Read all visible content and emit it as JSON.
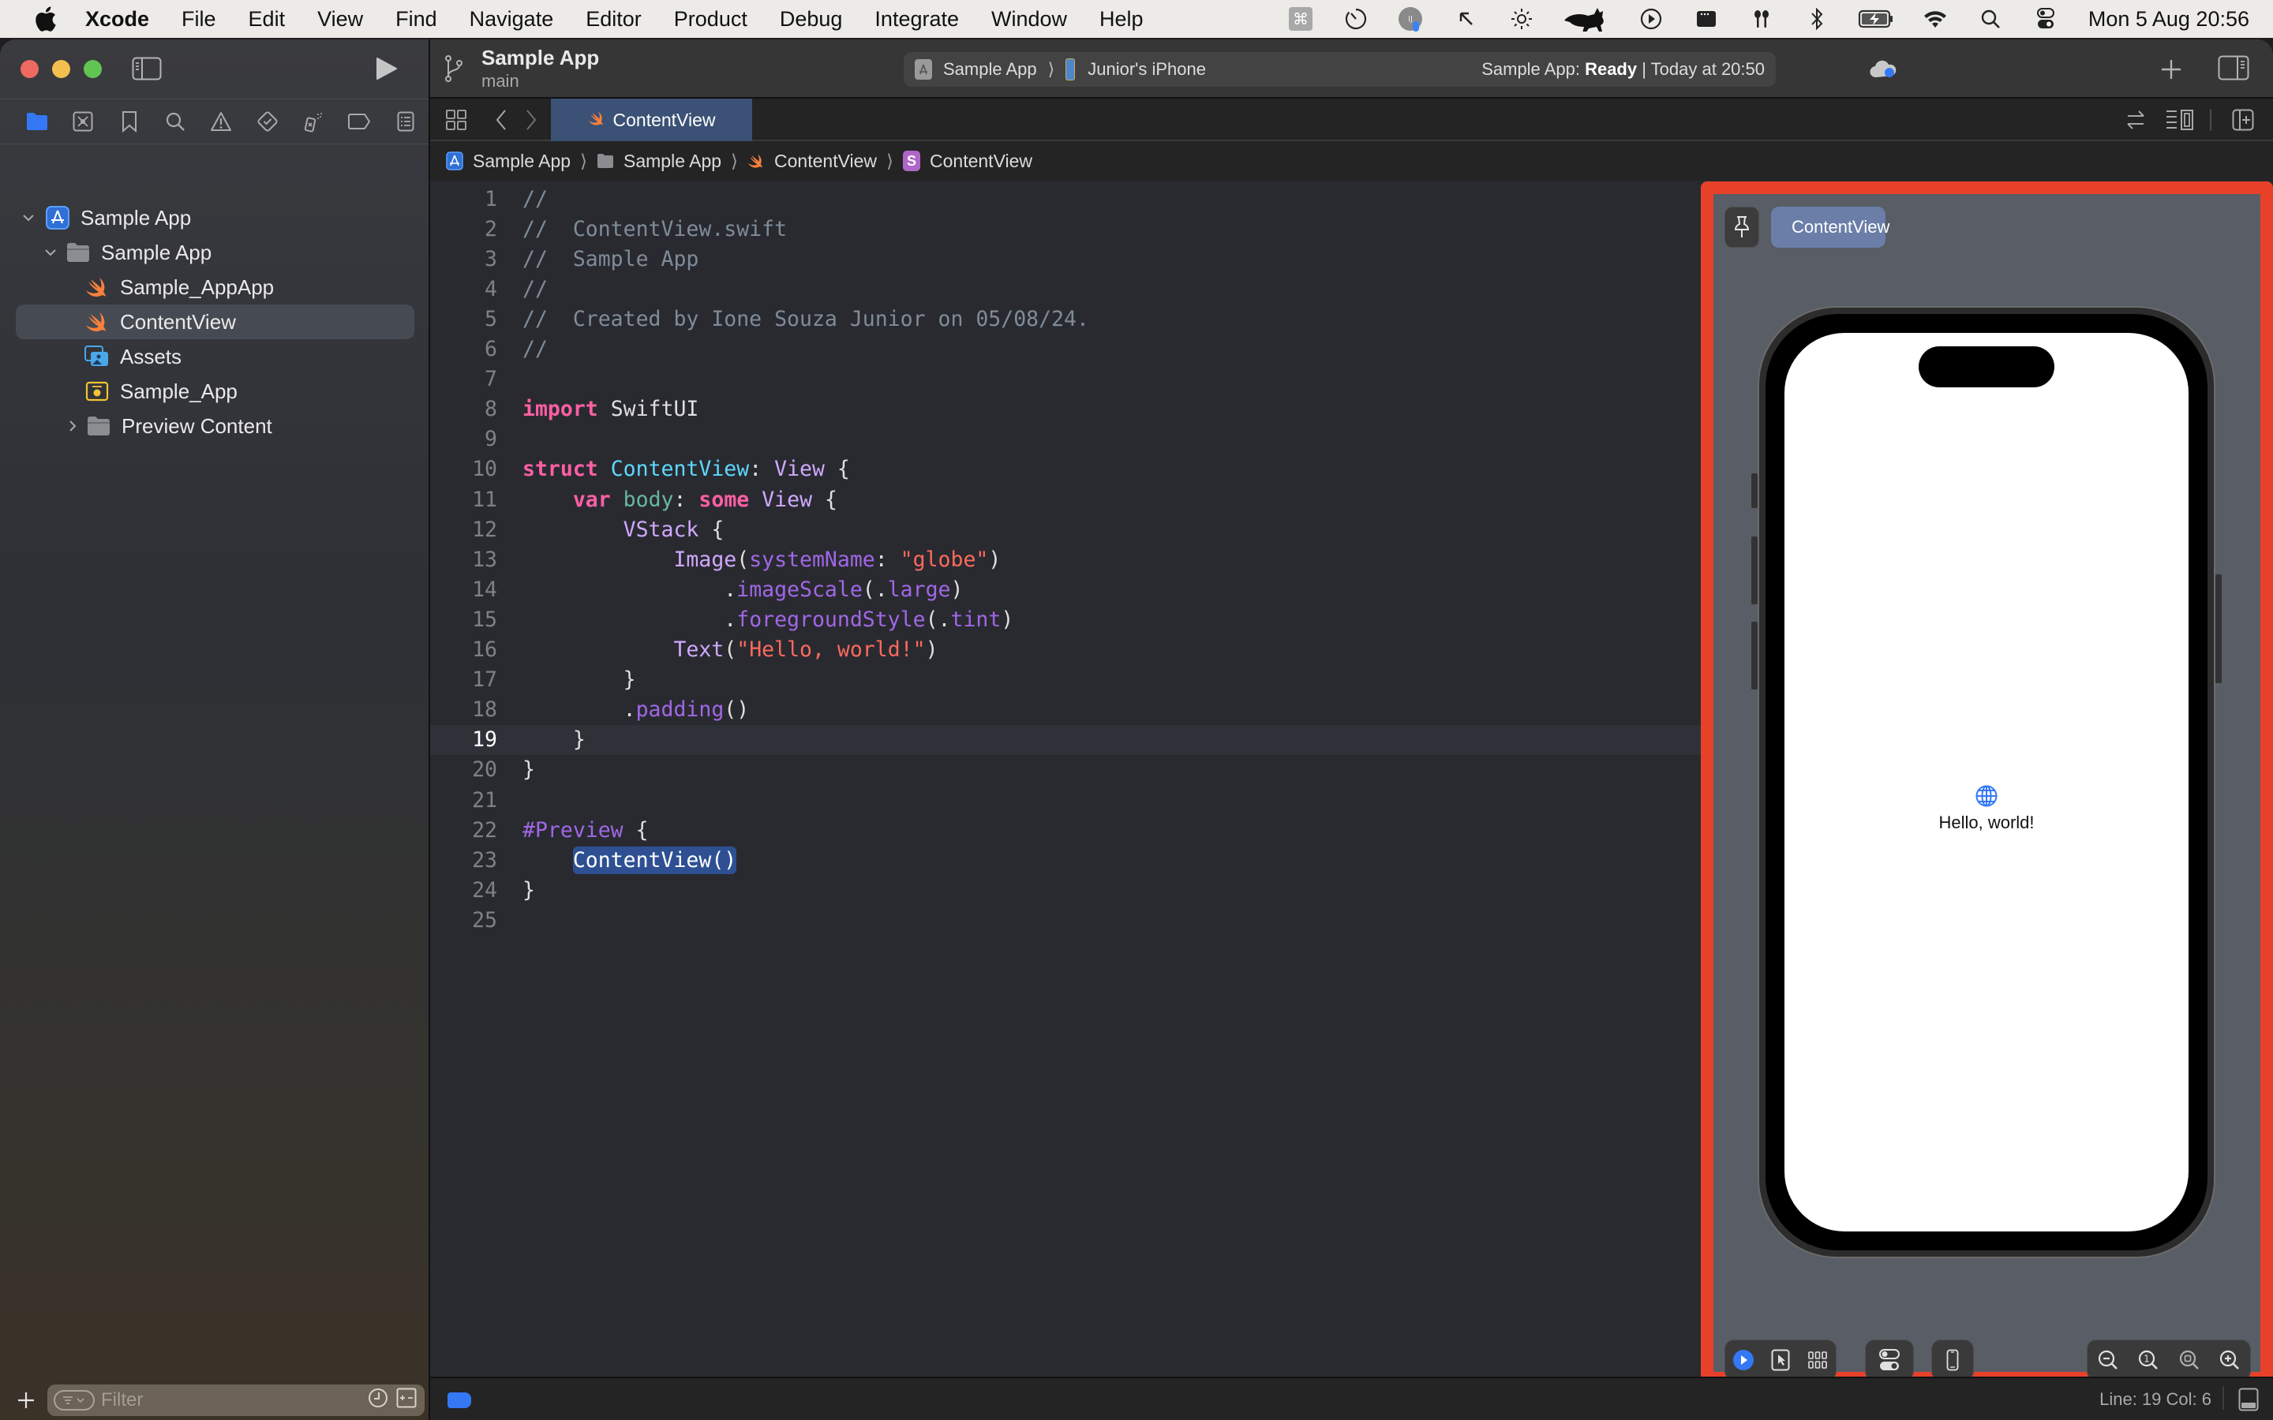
{
  "menubar": {
    "app_name": "Xcode",
    "items": [
      "File",
      "Edit",
      "View",
      "Find",
      "Navigate",
      "Editor",
      "Product",
      "Debug",
      "Integrate",
      "Window",
      "Help"
    ],
    "status_icons": [
      "command-key-icon",
      "timer-icon",
      "user-avatar-icon",
      "cursor-arrow-icon",
      "brightness-icon",
      "cat-icon",
      "play-circle-icon",
      "dock-icon",
      "airpods-icon",
      "bluetooth-icon",
      "battery-charging-icon",
      "wifi-icon",
      "spotlight-search-icon",
      "control-center-icon"
    ],
    "clock": "Mon 5 Aug  20:56",
    "avatar_initials": "IJ"
  },
  "toolbar": {
    "project_name": "Sample App",
    "branch": "main",
    "scheme": "Sample App",
    "device": "Junior's iPhone",
    "status_prefix": "Sample App: ",
    "status_state": "Ready",
    "status_suffix": " | Today at 20:50"
  },
  "navigator": {
    "tabs": [
      "project-navigator",
      "source-control-navigator",
      "bookmark-navigator",
      "find-navigator",
      "issue-navigator",
      "test-navigator",
      "debug-navigator",
      "breakpoint-navigator",
      "report-navigator"
    ],
    "active_tab": "project-navigator",
    "tree": [
      {
        "label": "Sample App",
        "type": "project",
        "level": 0,
        "expanded": true
      },
      {
        "label": "Sample App",
        "type": "folder",
        "level": 1,
        "expanded": true
      },
      {
        "label": "Sample_AppApp",
        "type": "swift",
        "level": 2
      },
      {
        "label": "ContentView",
        "type": "swift",
        "level": 2,
        "selected": true
      },
      {
        "label": "Assets",
        "type": "assets",
        "level": 2
      },
      {
        "label": "Sample_App",
        "type": "entitlements",
        "level": 2
      },
      {
        "label": "Preview Content",
        "type": "folder",
        "level": 2,
        "expanded": false
      }
    ],
    "filter_placeholder": "Filter"
  },
  "tabs": [
    {
      "label": "ContentView",
      "active": true
    }
  ],
  "breadcrumb": [
    {
      "label": "Sample App",
      "icon": "project-icon"
    },
    {
      "label": "Sample App",
      "icon": "folder-icon"
    },
    {
      "label": "ContentView",
      "icon": "swift-file-icon"
    },
    {
      "label": "ContentView",
      "icon": "struct-icon",
      "badge": "S"
    }
  ],
  "editor": {
    "current_line": 19,
    "lines": [
      [
        {
          "t": "//",
          "c": "comment"
        }
      ],
      [
        {
          "t": "//  ContentView.swift",
          "c": "comment"
        }
      ],
      [
        {
          "t": "//  Sample App",
          "c": "comment"
        }
      ],
      [
        {
          "t": "//",
          "c": "comment"
        }
      ],
      [
        {
          "t": "//  Created by Ione Souza Junior on 05/08/24.",
          "c": "comment"
        }
      ],
      [
        {
          "t": "//",
          "c": "comment"
        }
      ],
      [],
      [
        {
          "t": "import",
          "c": "keyword"
        },
        {
          "t": " SwiftUI",
          "c": "plain"
        }
      ],
      [],
      [
        {
          "t": "struct",
          "c": "keyword"
        },
        {
          "t": " ",
          "c": "plain"
        },
        {
          "t": "ContentView",
          "c": "type"
        },
        {
          "t": ": ",
          "c": "plain"
        },
        {
          "t": "View",
          "c": "sys"
        },
        {
          "t": " {",
          "c": "plain"
        }
      ],
      [
        {
          "t": "    ",
          "c": "plain"
        },
        {
          "t": "var",
          "c": "keyword"
        },
        {
          "t": " ",
          "c": "plain"
        },
        {
          "t": "body",
          "c": "prop"
        },
        {
          "t": ": ",
          "c": "plain"
        },
        {
          "t": "some",
          "c": "keyword"
        },
        {
          "t": " ",
          "c": "plain"
        },
        {
          "t": "View",
          "c": "sys"
        },
        {
          "t": " {",
          "c": "plain"
        }
      ],
      [
        {
          "t": "        ",
          "c": "plain"
        },
        {
          "t": "VStack",
          "c": "sys"
        },
        {
          "t": " {",
          "c": "plain"
        }
      ],
      [
        {
          "t": "            ",
          "c": "plain"
        },
        {
          "t": "Image",
          "c": "sys"
        },
        {
          "t": "(",
          "c": "plain"
        },
        {
          "t": "systemName",
          "c": "call"
        },
        {
          "t": ": ",
          "c": "plain"
        },
        {
          "t": "\"globe\"",
          "c": "string"
        },
        {
          "t": ")",
          "c": "plain"
        }
      ],
      [
        {
          "t": "                .",
          "c": "plain"
        },
        {
          "t": "imageScale",
          "c": "call"
        },
        {
          "t": "(.",
          "c": "plain"
        },
        {
          "t": "large",
          "c": "call"
        },
        {
          "t": ")",
          "c": "plain"
        }
      ],
      [
        {
          "t": "                .",
          "c": "plain"
        },
        {
          "t": "foregroundStyle",
          "c": "call"
        },
        {
          "t": "(.",
          "c": "plain"
        },
        {
          "t": "tint",
          "c": "call"
        },
        {
          "t": ")",
          "c": "plain"
        }
      ],
      [
        {
          "t": "            ",
          "c": "plain"
        },
        {
          "t": "Text",
          "c": "sys"
        },
        {
          "t": "(",
          "c": "plain"
        },
        {
          "t": "\"Hello, world!\"",
          "c": "string"
        },
        {
          "t": ")",
          "c": "plain"
        }
      ],
      [
        {
          "t": "        }",
          "c": "plain"
        }
      ],
      [
        {
          "t": "        .",
          "c": "plain"
        },
        {
          "t": "padding",
          "c": "call"
        },
        {
          "t": "()",
          "c": "plain"
        }
      ],
      [
        {
          "t": "    }",
          "c": "plain"
        }
      ],
      [
        {
          "t": "}",
          "c": "plain"
        }
      ],
      [],
      [
        {
          "t": "#Preview",
          "c": "macro"
        },
        {
          "t": " {",
          "c": "plain"
        }
      ],
      [
        {
          "t": "    ",
          "c": "plain"
        },
        {
          "t": "ContentView()",
          "c": "selected"
        }
      ],
      [
        {
          "t": "}",
          "c": "plain"
        }
      ],
      []
    ]
  },
  "preview": {
    "chip_label": "ContentView",
    "app_text": "Hello, world!",
    "app_icon": "globe-icon",
    "accent_color": "#3478f6",
    "highlight_color": "#e8412a",
    "bottom_left_controls": [
      "live-mode-button",
      "selectable-mode-button",
      "variants-button"
    ],
    "device_settings_button": "device-settings-button",
    "device_button": "device-button",
    "zoom_controls": [
      "zoom-out-button",
      "zoom-100-button",
      "zoom-to-fit-button",
      "zoom-in-button"
    ]
  },
  "statusbar": {
    "line_col": "Line: 19  Col: 6"
  }
}
